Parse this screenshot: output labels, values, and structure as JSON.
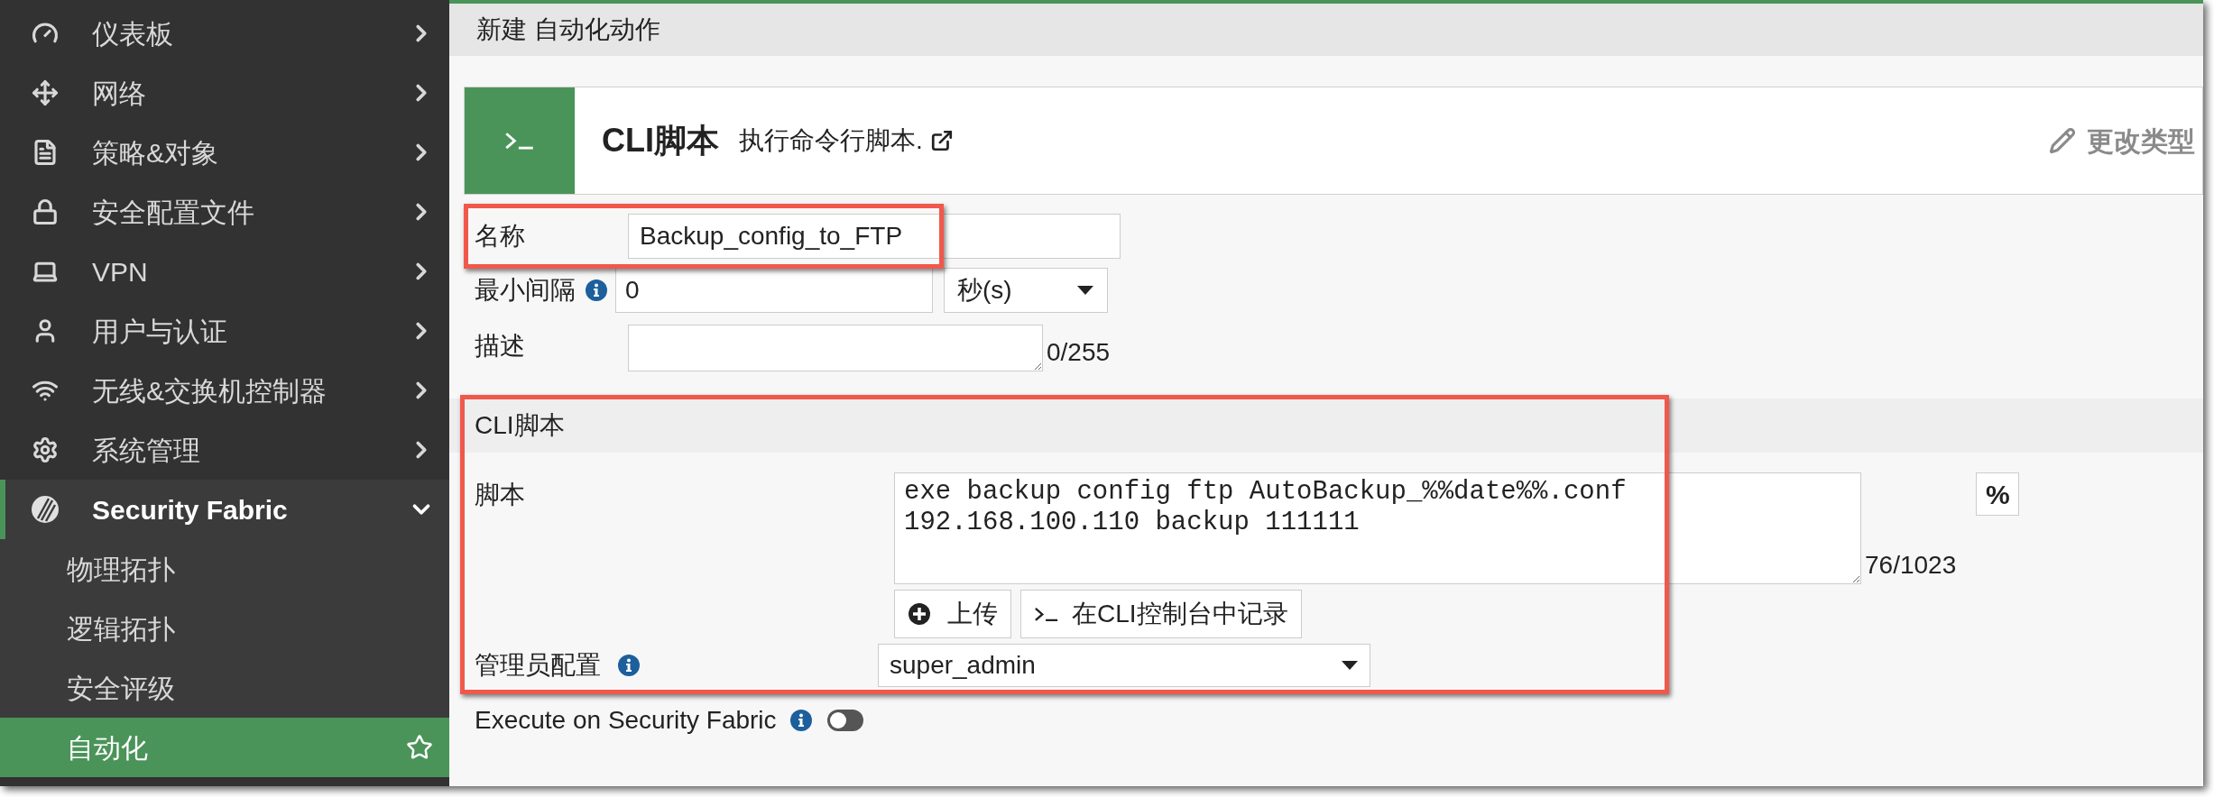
{
  "sidebar": {
    "items": [
      {
        "label": "仪表板",
        "expanded": false
      },
      {
        "label": "网络",
        "expanded": false
      },
      {
        "label": "策略&对象",
        "expanded": false
      },
      {
        "label": "安全配置文件",
        "expanded": false
      },
      {
        "label": "VPN",
        "expanded": false
      },
      {
        "label": "用户与认证",
        "expanded": false
      },
      {
        "label": "无线&交换机控制器",
        "expanded": false
      },
      {
        "label": "系统管理",
        "expanded": false
      },
      {
        "label": "Security Fabric",
        "expanded": true,
        "children": [
          {
            "label": "物理拓扑",
            "selected": false
          },
          {
            "label": "逻辑拓扑",
            "selected": false
          },
          {
            "label": "安全评级",
            "selected": false
          },
          {
            "label": "自动化",
            "selected": true
          }
        ]
      }
    ]
  },
  "header": {
    "title": "新建 自动化动作"
  },
  "action": {
    "title": "CLI脚本",
    "description": "执行命令行脚本.",
    "change_type": "更改类型"
  },
  "form": {
    "name": {
      "label": "名称",
      "value": "Backup_config_to_FTP",
      "highlighted": true
    },
    "min_interval": {
      "label": "最小间隔",
      "value": "0",
      "unit": "秒(s)"
    },
    "description": {
      "label": "描述",
      "counter": "0/255"
    }
  },
  "cli_section": {
    "title": "CLI脚本",
    "highlighted": true,
    "script": {
      "label": "脚本",
      "value": "exe backup config ftp AutoBackup_%%date%%.conf 192.168.100.110 backup 111111",
      "counter": "76/1023",
      "percent_button": "%"
    },
    "buttons": [
      "上传",
      "在CLI控制台中记录"
    ],
    "admin_profile": {
      "label": "管理员配置",
      "value": "super_admin"
    }
  },
  "execute_on_fabric": {
    "label": "Execute on Security Fabric",
    "on": false
  }
}
